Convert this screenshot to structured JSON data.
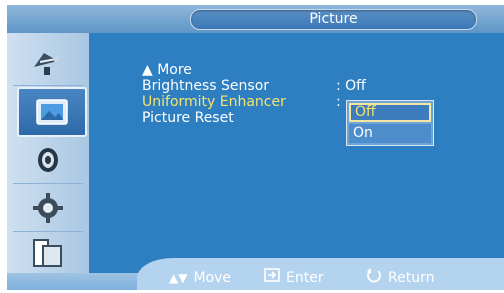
{
  "title": "Picture",
  "sidebar": {
    "items": [
      {
        "icon": "satellite-dish-icon"
      },
      {
        "icon": "picture-icon",
        "active": true
      },
      {
        "icon": "speaker-icon"
      },
      {
        "icon": "gear-icon"
      },
      {
        "icon": "multi-window-icon"
      }
    ]
  },
  "menu": {
    "more_label": "▲ More",
    "items": [
      {
        "label": "Brightness Sensor",
        "value": ": Off"
      },
      {
        "label": "Uniformity Enhancer",
        "value": ":"
      },
      {
        "label": "Picture Reset"
      }
    ]
  },
  "dropdown": {
    "options": [
      "Off",
      "On"
    ],
    "selected": "Off"
  },
  "help": {
    "move": "Move",
    "enter": "Enter",
    "return": "Return"
  },
  "colors": {
    "panel": "#2d7fc2",
    "highlight_text": "#f6e46a"
  }
}
